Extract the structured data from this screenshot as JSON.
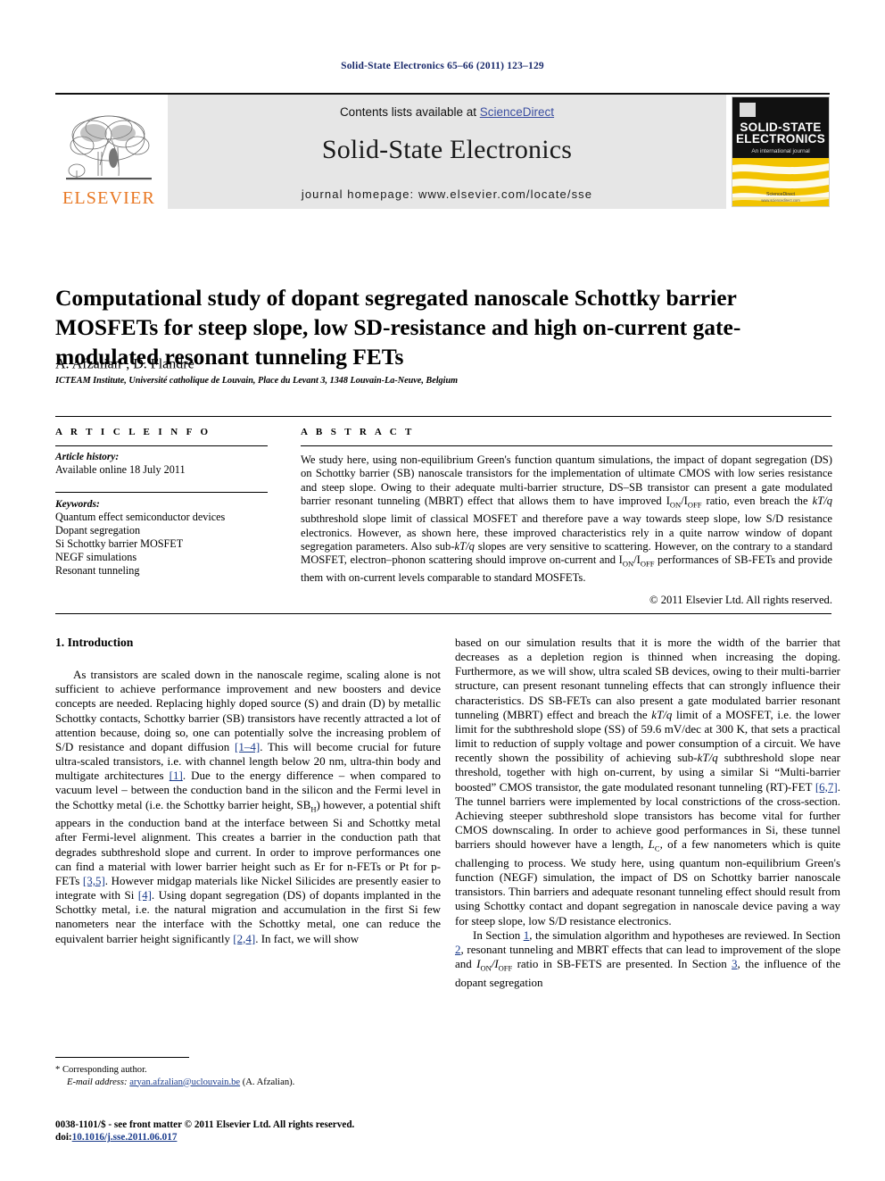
{
  "running_head": "Solid-State Electronics 65–66 (2011) 123–129",
  "masthead": {
    "publisher_name": "ELSEVIER",
    "contents_prefix": "Contents lists available at ",
    "sciencedirect": "ScienceDirect",
    "journal_title": "Solid-State Electronics",
    "homepage": "journal homepage: www.elsevier.com/locate/sse",
    "cover": {
      "line1": "SOLID-STATE",
      "line2": "ELECTRONICS",
      "tagline": "An international journal",
      "footer_brand": "ScienceDirect",
      "footer_url": "www.sciencedirect.com"
    },
    "colors": {
      "banner_bg": "#e6e6e6",
      "elsevier_orange": "#E87722",
      "link_blue": "#3b4ea0",
      "cover_yellow": "#f2c300",
      "cover_black": "#111111"
    }
  },
  "article": {
    "title": "Computational study of dopant segregated nanoscale Schottky barrier MOSFETs for steep slope, low SD-resistance and high on-current gate-modulated resonant tunneling FETs",
    "authors_pre": "A. Afzalian",
    "authors_star": "*",
    "authors_post": ", D. Flandre",
    "affiliation": "ICTEAM Institute, Université catholique de Louvain, Place du Levant 3, 1348 Louvain-La-Neuve, Belgium"
  },
  "article_info": {
    "heading": "A R T I C L E   I N F O",
    "history_label": "Article history:",
    "history_value": "Available online 18 July 2011",
    "keywords_label": "Keywords:",
    "keywords": [
      "Quantum effect semiconductor devices",
      "Dopant segregation",
      "Si Schottky barrier MOSFET",
      "NEGF simulations",
      "Resonant tunneling"
    ]
  },
  "abstract": {
    "heading": "A B S T R A C T",
    "paragraph_1": "We study here, using non-equilibrium Green's function quantum simulations, the impact of dopant segregation (DS) on Schottky barrier (SB) nanoscale transistors for the implementation of ultimate CMOS with low series resistance and steep slope. Owing to their adequate multi-barrier structure, DS–SB transistor can present a gate modulated barrier resonant tunneling (MBRT) effect that allows them to have improved ",
    "ratio_1": "I",
    "ratio_1_sub": "ON",
    "ratio_1_mid": "/I",
    "ratio_1_sub2": "OFF",
    "paragraph_2": " ratio, even breach the ",
    "kTq_1": "kT/q",
    "paragraph_3": " subthreshold slope limit of classical MOSFET and therefore pave a way towards steep slope, low S/D resistance electronics. However, as shown here, these improved characteristics rely in a quite narrow window of dopant segregation parameters. Also sub-",
    "kTq_2": "kT/q",
    "paragraph_4": " slopes are very sensitive to scattering. However, on the contrary to a standard MOSFET, electron–phonon scattering should improve on-current and ",
    "paragraph_5": " performances of SB-FETs and provide them with on-current levels comparable to standard MOSFETs.",
    "copyright": "© 2011 Elsevier Ltd. All rights reserved."
  },
  "body": {
    "section_heading": "1. Introduction",
    "left": {
      "p1_a": "As transistors are scaled down in the nanoscale regime, scaling alone is not sufficient to achieve performance improvement and new boosters and device concepts are needed. Replacing highly doped source (S) and drain (D) by metallic Schottky contacts, Schottky barrier (SB) transistors have recently attracted a lot of attention because, doing so, one can potentially solve the increasing problem of S/D resistance and dopant diffusion ",
      "ref1": "[1–4]",
      "p1_b": ". This will become crucial for future ultra-scaled transistors, i.e. with channel length below 20 nm, ultra-thin body and multigate architectures ",
      "ref2": "[1]",
      "p1_c": ". Due to the energy difference – when compared to vacuum level – between the conduction band in the silicon and the Fermi level in the Schottky metal (i.e. the Schottky barrier height, SB",
      "sbh_sub": "H",
      "p1_d": ") however, a potential shift appears in the conduction band at the interface between Si and Schottky metal after Fermi-level alignment. This creates a barrier in the conduction path that degrades subthreshold slope and current. In order to improve performances one can find a material with lower barrier height such as Er for n-FETs or Pt for p-FETs ",
      "ref3": "[3,5]",
      "p1_e": ". However midgap materials like Nickel Silicides are presently easier to integrate with Si ",
      "ref4": "[4]",
      "p1_f": ". Using dopant segregation (DS) of dopants implanted in the Schottky metal, i.e. the natural migration and accumulation in the first Si few nanometers near the interface with the Schottky metal, one can reduce the equivalent barrier height significantly ",
      "ref5": "[2,4]",
      "p1_g": ". In fact, we will show"
    },
    "right": {
      "p1_a": "based on our simulation results that it is more the width of the barrier that decreases as a depletion region is thinned when increasing the doping. Furthermore, as we will show, ultra scaled SB devices, owing to their multi-barrier structure, can present resonant tunneling effects that can strongly influence their characteristics. DS SB-FETs can also present a gate modulated barrier resonant tunneling (MBRT) effect and breach the ",
      "kTq": "kT/q",
      "p1_b": " limit of a MOSFET, i.e. the lower limit for the subthreshold slope (SS) of 59.6 mV/dec at 300 K, that sets a practical limit to reduction of supply voltage and power consumption of a circuit. We have recently shown the possibility of achieving sub-",
      "kTq2": "kT/q",
      "p1_c": " subthreshold slope near threshold, together with high on-current, by using a similar Si “Multi-barrier boosted” CMOS transistor, the gate modulated resonant tunneling (RT)-FET ",
      "ref6": "[6,7]",
      "p1_d": ". The tunnel barriers were implemented by local constrictions of the cross-section. Achieving steeper subthreshold slope transistors has become vital for further CMOS downscaling. In order to achieve good performances in Si, these tunnel barriers should however have a length, ",
      "lc": "L",
      "lc_sub": "C",
      "p1_e": ", of a few nanometers which is quite challenging to process. We study here, using quantum non-equilibrium Green's function (NEGF) simulation, the impact of DS on Schottky barrier nanoscale transistors. Thin barriers and adequate resonant tunneling effect should result from using Schottky contact and dopant segregation in nanoscale device paving a way for steep slope, low S/D resistance electronics.",
      "p2_a": "In Section ",
      "sec1": "1",
      "p2_b": ", the simulation algorithm and hypotheses are reviewed. In Section ",
      "sec2": "2",
      "p2_c": ", resonant tunneling and MBRT effects that can lead to improvement of the slope and ",
      "p2_d": " ratio in SB-FETS are presented. In Section ",
      "sec3": "3",
      "p2_e": ", the influence of the dopant segregation"
    }
  },
  "footnote": {
    "corresponding": "* Corresponding author.",
    "email_label": "E-mail address:",
    "email": "aryan.afzalian@uclouvain.be",
    "email_suffix": " (A. Afzalian).",
    "issn_line": "0038-1101/$ - see front matter © 2011 Elsevier Ltd. All rights reserved.",
    "doi_label": "doi:",
    "doi_value": "10.1016/j.sse.2011.06.017"
  }
}
